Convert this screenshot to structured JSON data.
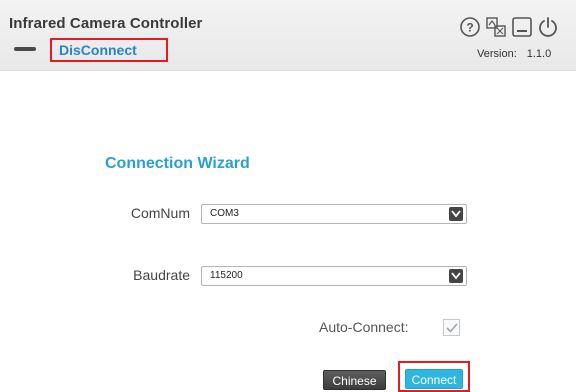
{
  "header": {
    "title": "Infrared Camera Controller",
    "disconnect_label": "DisConnect",
    "version_label": "Version:",
    "version_value": "1.1.0",
    "icons": [
      "help-icon",
      "window-switch-icon",
      "minimize-icon",
      "power-icon"
    ]
  },
  "wizard": {
    "title": "Connection Wizard",
    "comnum": {
      "label": "ComNum",
      "value": "COM3"
    },
    "baudrate": {
      "label": "Baudrate",
      "value": "115200"
    },
    "auto_connect": {
      "label": "Auto-Connect:",
      "checked": true
    },
    "chinese_label": "Chinese",
    "connect_label": "Connect"
  },
  "colors": {
    "accent": "#2a9fd6",
    "highlight_red": "#e31b23",
    "connect_button": "#2fb6e0",
    "chinese_button": "#4a4a4a"
  }
}
